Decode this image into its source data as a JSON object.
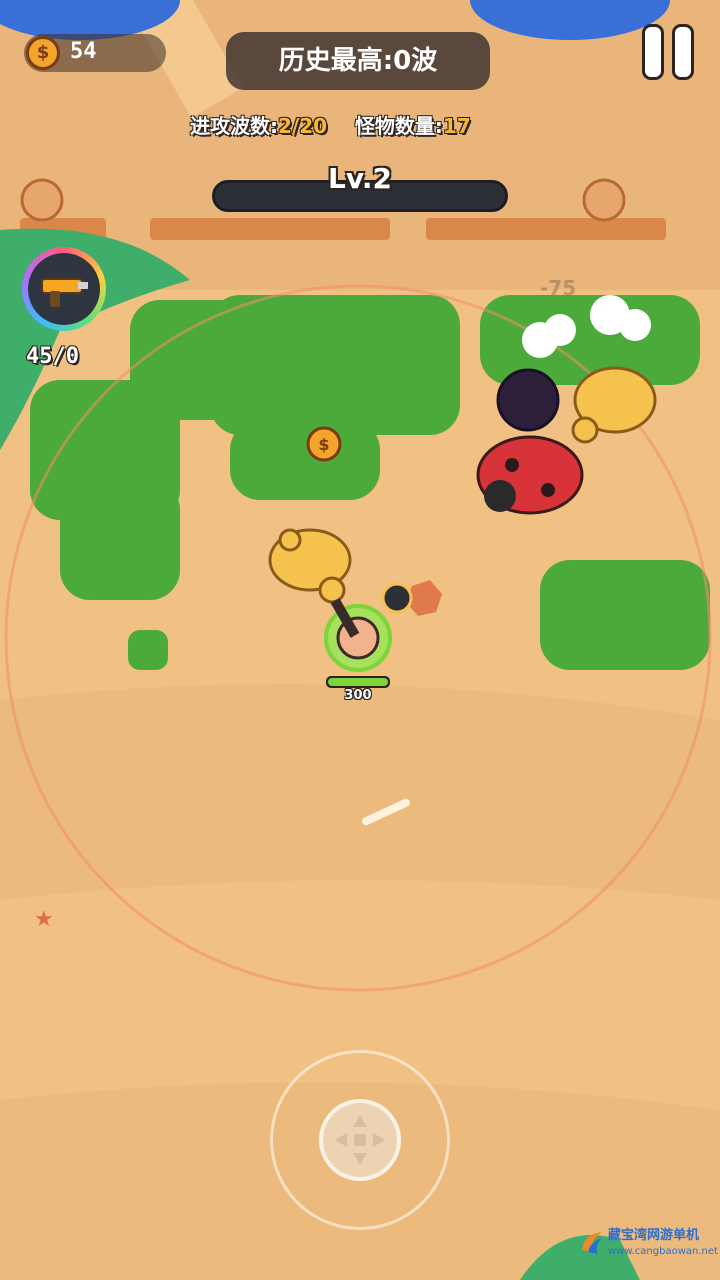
{
  "hud": {
    "coins": "54",
    "coin_symbol": "$",
    "best_label": "历史最高:0波",
    "wave_label": "进攻波数:",
    "wave_value": "2/20",
    "monster_label": "怪物数量:",
    "monster_value": "17",
    "level": "Lv.2",
    "level_progress": 0.0,
    "ammo": "45/0",
    "player_hp": "300",
    "damage_number": "-75"
  },
  "watermark": {
    "name": "藏宝湾网游单机",
    "url": "www.cangbaowan.net"
  },
  "icons": [
    "coin-icon",
    "pause-icon",
    "weapon-icon",
    "joystick-arrows-icon"
  ],
  "colors": {
    "sand": "#f1c083",
    "grass": "#4caa3a",
    "player_ring": "#7bd43a",
    "accent_value": "#f7b733"
  }
}
